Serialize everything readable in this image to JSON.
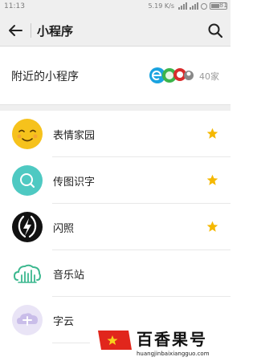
{
  "status_bar": {
    "time": "11:13",
    "speed": "5.19 K/s",
    "battery": "81"
  },
  "nav": {
    "title": "小程序"
  },
  "nearby": {
    "label": "附近的小程序",
    "count": "40家"
  },
  "list": [
    {
      "name": "表情家园",
      "icon": "smiley-face-icon",
      "starred": true
    },
    {
      "name": "传图识字",
      "icon": "magnifier-icon",
      "starred": true
    },
    {
      "name": "闪照",
      "icon": "lightning-icon",
      "starred": true
    },
    {
      "name": "音乐站",
      "icon": "music-cloud-icon",
      "starred": false
    },
    {
      "name": "字云",
      "icon": "word-cloud-icon",
      "starred": false
    }
  ],
  "watermark": {
    "title": "百香果号",
    "url": "huangjinbaixiangguo.com"
  },
  "colors": {
    "star": "#f5b800",
    "header_bg": "#efefef",
    "smiley": "#f6c21c",
    "magnifier_bg": "#4ec9c2"
  }
}
